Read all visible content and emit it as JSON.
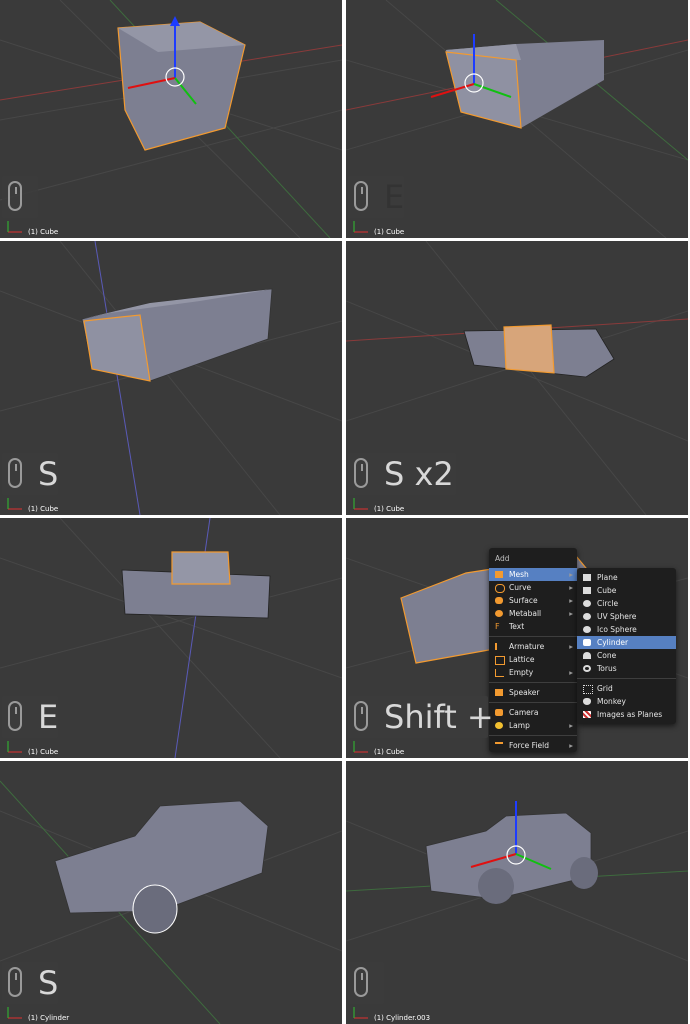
{
  "panels": [
    {
      "label": "(1) Cube",
      "key": ""
    },
    {
      "label": "(1) Cube",
      "key": "E"
    },
    {
      "label": "(1) Cube",
      "key": "S"
    },
    {
      "label": "(1) Cube",
      "key": "S x2"
    },
    {
      "label": "(1) Cube",
      "key": "E"
    },
    {
      "label": "(1) Cube",
      "key": "Shift +"
    },
    {
      "label": "(1) Cylinder",
      "key": "S"
    },
    {
      "label": "(1) Cylinder.003",
      "key": ""
    }
  ],
  "add_menu": {
    "title": "Add",
    "items": [
      {
        "label": "Mesh",
        "icon": "mesh-icon",
        "submenu": true,
        "active": true
      },
      {
        "label": "Curve",
        "icon": "curve-icon",
        "submenu": true
      },
      {
        "label": "Surface",
        "icon": "surface-icon",
        "submenu": true
      },
      {
        "label": "Metaball",
        "icon": "metaball-icon",
        "submenu": true
      },
      {
        "label": "Text",
        "icon": "text-icon",
        "submenu": false
      },
      {
        "label": "Armature",
        "icon": "armature-icon",
        "submenu": true
      },
      {
        "label": "Lattice",
        "icon": "lattice-icon",
        "submenu": false
      },
      {
        "label": "Empty",
        "icon": "empty-icon",
        "submenu": true
      },
      {
        "label": "Speaker",
        "icon": "speaker-icon",
        "submenu": false
      },
      {
        "label": "Camera",
        "icon": "camera-icon",
        "submenu": false
      },
      {
        "label": "Lamp",
        "icon": "lamp-icon",
        "submenu": true
      },
      {
        "label": "Force Field",
        "icon": "force-field-icon",
        "submenu": true
      }
    ]
  },
  "mesh_submenu": {
    "items": [
      {
        "label": "Plane",
        "icon": "plane-icon"
      },
      {
        "label": "Cube",
        "icon": "cube-icon"
      },
      {
        "label": "Circle",
        "icon": "circle-icon"
      },
      {
        "label": "UV Sphere",
        "icon": "uv-sphere-icon"
      },
      {
        "label": "Ico Sphere",
        "icon": "ico-sphere-icon"
      },
      {
        "label": "Cylinder",
        "icon": "cylinder-icon",
        "active": true
      },
      {
        "label": "Cone",
        "icon": "cone-icon"
      },
      {
        "label": "Torus",
        "icon": "torus-icon"
      },
      {
        "label": "Grid",
        "icon": "grid-icon"
      },
      {
        "label": "Monkey",
        "icon": "monkey-icon"
      },
      {
        "label": "Images as Planes",
        "icon": "images-as-planes-icon"
      }
    ]
  },
  "colors": {
    "viewport": "#3a3a3a",
    "selection": "#f29a30",
    "menu_active": "#5680c2",
    "mesh": "#7d7f91"
  }
}
